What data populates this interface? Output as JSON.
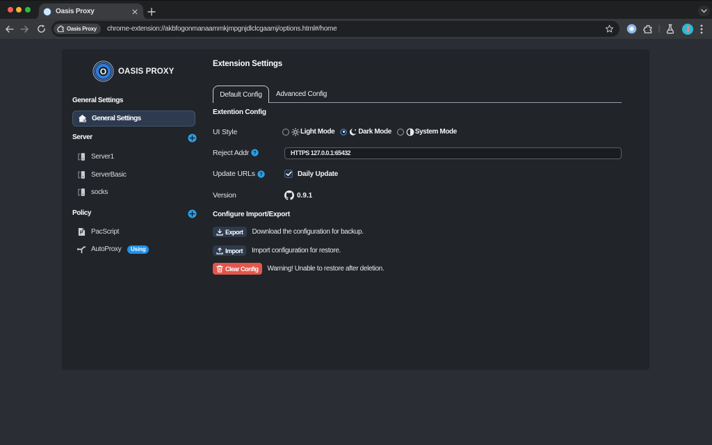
{
  "browser": {
    "tab_title": "Oasis Proxy",
    "url": "chrome-extension://akbfogonmanaammkjmpgnjdlclcgaamj/options.html#/home",
    "chip_label": "Oasis Proxy"
  },
  "sidebar": {
    "logo_text": "OASIS PROXY",
    "groups": [
      {
        "label": "General Settings",
        "items": [
          {
            "label": "General Settings",
            "selected": true
          }
        ]
      },
      {
        "label": "Server",
        "has_add_button": true,
        "items": [
          {
            "label": "Server1"
          },
          {
            "label": "ServerBasic"
          },
          {
            "label": "socks"
          }
        ]
      },
      {
        "label": "Policy",
        "has_add_button": true,
        "items": [
          {
            "label": "PacScript"
          },
          {
            "label": "AutoProxy",
            "badge": "Using"
          }
        ]
      }
    ]
  },
  "main": {
    "title": "Extension Settings",
    "tabs": [
      {
        "label": "Default Config",
        "active": true
      },
      {
        "label": "Advanced Config",
        "active": false
      }
    ],
    "sections": {
      "config": "Extention Config",
      "import_export": "Configure Import/Export"
    },
    "fields": {
      "ui_style": {
        "label": "UI Style",
        "options": [
          {
            "label": "Light Mode",
            "selected": false
          },
          {
            "label": "Dark Mode",
            "selected": true
          },
          {
            "label": "System Mode",
            "selected": false
          }
        ]
      },
      "reject_addr": {
        "label": "Reject Addr",
        "value": "HTTPS 127.0.0.1:65432"
      },
      "update_urls": {
        "label": "Update URLs",
        "checkbox_label": "Daily Update",
        "checked": true
      },
      "version": {
        "label": "Version",
        "value": "0.9.1"
      }
    },
    "actions": {
      "export": {
        "button": "Export",
        "desc": "Download the configuration for backup."
      },
      "import": {
        "button": "Import",
        "desc": "Import configuration for restore."
      },
      "clear": {
        "button": "Clear Config",
        "desc": "Warning! Unable to restore after deletion."
      }
    }
  },
  "colors": {
    "accent": "#2b9fe8",
    "badge": "#2090e9",
    "danger": "#e4564c",
    "card_bg": "#212429",
    "page_bg": "#2a2e34"
  }
}
